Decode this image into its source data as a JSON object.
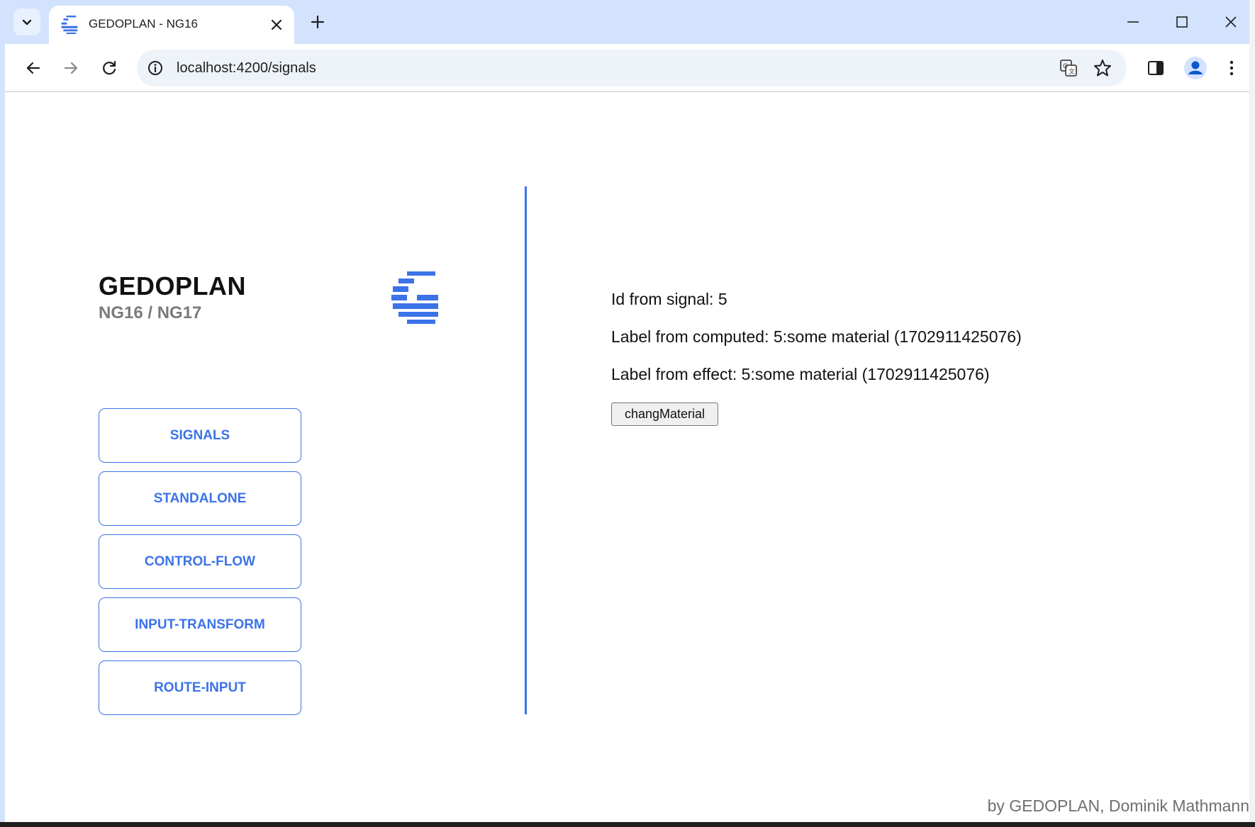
{
  "browser": {
    "tab_title": "GEDOPLAN - NG16",
    "url": "localhost:4200/signals"
  },
  "brand": {
    "title": "GEDOPLAN",
    "subtitle": "NG16 / NG17",
    "logo_icon": "gedoplan-g-logo-icon",
    "accent_color": "#3b73e8"
  },
  "nav": {
    "items": [
      {
        "label": "SIGNALS"
      },
      {
        "label": "STANDALONE"
      },
      {
        "label": "CONTROL-FLOW"
      },
      {
        "label": "INPUT-TRANSFORM"
      },
      {
        "label": "ROUTE-INPUT"
      }
    ]
  },
  "content": {
    "id_line": "Id from signal: 5",
    "computed_line": "Label from computed: 5:some material (1702911425076)",
    "effect_line": "Label from effect: 5:some material (1702911425076)",
    "button_label": "changMaterial"
  },
  "footer": {
    "credit": "by GEDOPLAN, Dominik Mathmann"
  }
}
